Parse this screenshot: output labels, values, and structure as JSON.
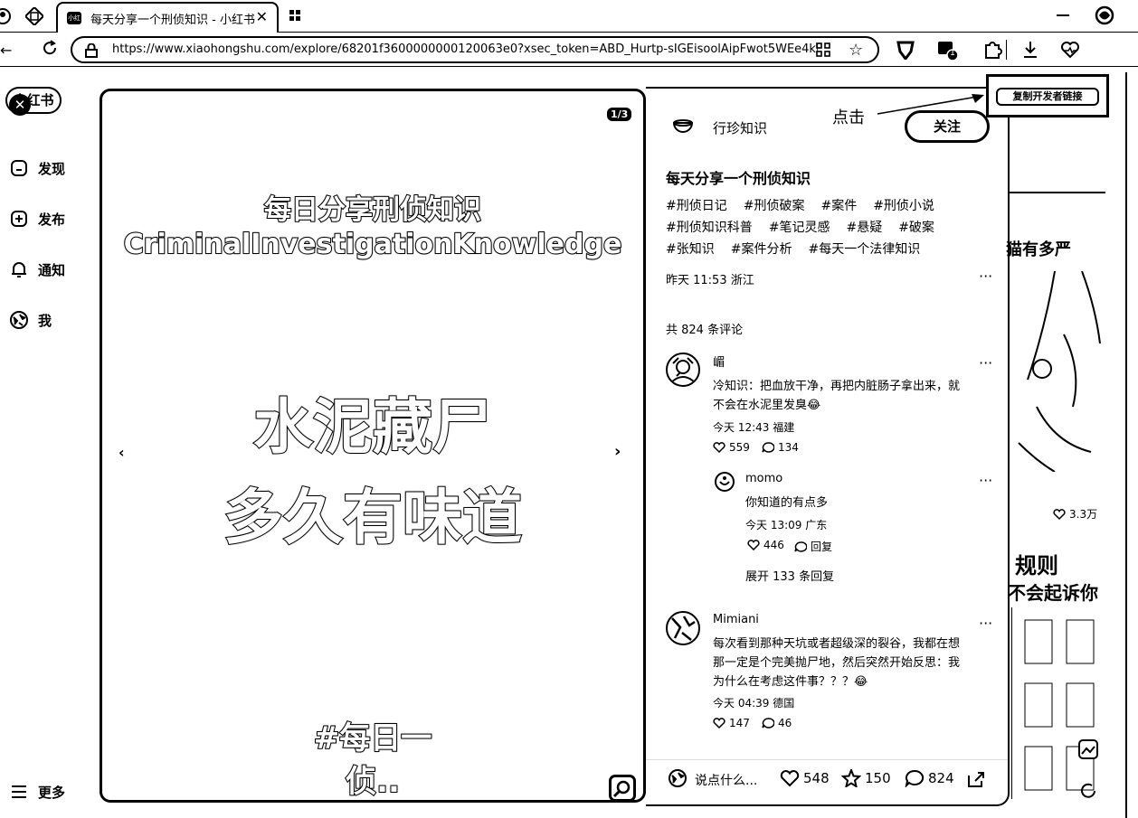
{
  "browser": {
    "tab_title": "每天分享一个刑侦知识 - 小红书",
    "url": "https://www.xiaohongshu.com/explore/68201f3600000000120063e0?xsec_token=ABD_Hurtp-sIGEisoolAipFwot5WEe4kL_...",
    "notify_count": "1"
  },
  "sidebar": {
    "logo": "小红书",
    "items": [
      {
        "label": "发现",
        "icon": "discover-icon"
      },
      {
        "label": "发布",
        "icon": "plus-circle-icon"
      },
      {
        "label": "通知",
        "icon": "bell-icon"
      },
      {
        "label": "我",
        "icon": "avatar-icon"
      }
    ],
    "more_label": "更多"
  },
  "image": {
    "page_indicator": "1/3",
    "line1": "每日分享刑侦知识",
    "line2": "CriminalInvestigationKnowledge",
    "big1": "水泥藏尸",
    "big2": "多久有味道",
    "hashtag1": "#每日一",
    "hashtag2": "侦.."
  },
  "overlay": {
    "click_hint": "点击",
    "copy_button": "复制开发者链接"
  },
  "post": {
    "author": "行珍知识",
    "follow_label": "关注",
    "title": "每天分享一个刑侦知识",
    "tags_lines": [
      [
        "#刑侦日记",
        "#刑侦破案",
        "#案件",
        "#刑侦小说"
      ],
      [
        "#刑侦知识科普",
        "#笔记灵感",
        "#悬疑",
        "#破案"
      ],
      [
        "#张知识",
        "#案件分析",
        "#每天一个法律知识"
      ]
    ],
    "meta": "昨天 11:53 浙江",
    "comments_count_label": "共 824 条评论"
  },
  "comments": [
    {
      "user": "嵋",
      "text1": "冷知识：把血放干净，再把内脏肠子拿出来，就",
      "text2": "不会在水泥里发臭😂",
      "meta": "今天 12:43 福建",
      "likes": "559",
      "replies": "134",
      "sub": {
        "user": "momo",
        "text": "你知道的有点多",
        "meta": "今天 13:09 广东",
        "likes": "446",
        "reply_label": "回复"
      },
      "expand_label": "展开 133 条回复"
    },
    {
      "user": "Mimiani",
      "text1": "每次看到那种天坑或者超级深的裂谷，我都在想",
      "text2": "那一定是个完美抛尸地，然后突然开始反思：我",
      "text3": "为什么在考虑这件事？？？😂",
      "meta": "今天 04:39 德国",
      "likes": "147",
      "replies": "46"
    }
  ],
  "bottom_bar": {
    "input_placeholder": "说点什么...",
    "likes": "548",
    "stars": "150",
    "comments": "824"
  },
  "background": {
    "text1": "猫有多严",
    "likes": "3.3万",
    "text2": "规则",
    "text3": "不会起诉你"
  }
}
